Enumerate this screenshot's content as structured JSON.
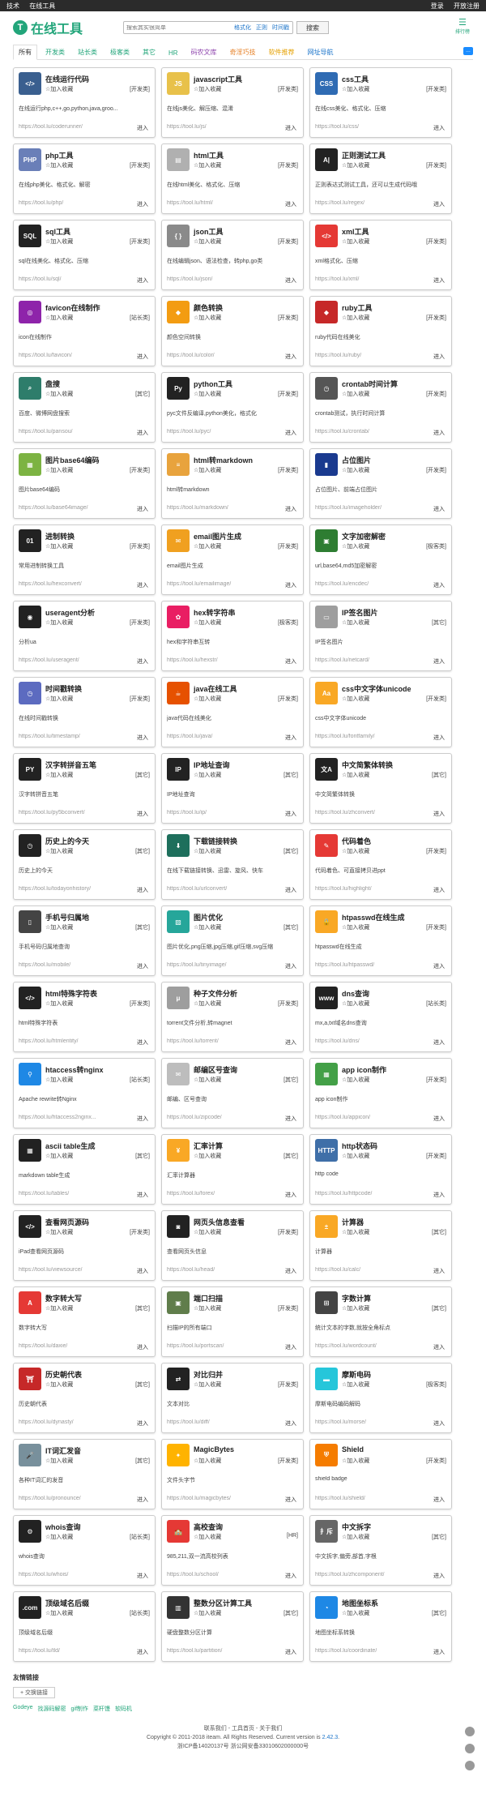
{
  "topbar": {
    "left": [
      "技术",
      "在线工具"
    ],
    "right": [
      "登录",
      "开放注册"
    ]
  },
  "header": {
    "logo_text": "在线工具",
    "search_placeholder": "搜索其实很简单",
    "search_tags": [
      "格式化",
      "正则",
      "时间戳"
    ],
    "search_button": "搜索",
    "ranking_label": "排行榜"
  },
  "nav": [
    "所有",
    "开发类",
    "站长类",
    "极客类",
    "其它",
    "HR",
    "码农文库",
    "奇淫巧技",
    "软件推荐",
    "网址导航"
  ],
  "common": {
    "fav": "☆加入收藏",
    "enter": "进入"
  },
  "tools": [
    {
      "title": "在线运行代码",
      "cat": "[开发类]",
      "desc": "在线运行php,c++,go,python,java,groo...",
      "url": "https://tool.lu/coderunner/",
      "color": "#3a5f8f",
      "glyph": "</>"
    },
    {
      "title": "javascript工具",
      "cat": "[开发类]",
      "desc": "在线js美化、解压缩、混淆",
      "url": "https://tool.lu/js/",
      "color": "#e8c14a",
      "glyph": "JS"
    },
    {
      "title": "css工具",
      "cat": "[开发类]",
      "desc": "在线css美化、格式化、压缩",
      "url": "https://tool.lu/css/",
      "color": "#2f6bb3",
      "glyph": "CSS"
    },
    {
      "title": "php工具",
      "cat": "[开发类]",
      "desc": "在线php美化、格式化、解密",
      "url": "https://tool.lu/php/",
      "color": "#6a7fb8",
      "glyph": "PHP"
    },
    {
      "title": "html工具",
      "cat": "[开发类]",
      "desc": "在线html美化、格式化、压缩",
      "url": "https://tool.lu/html/",
      "color": "#b0b0b0",
      "glyph": "▤"
    },
    {
      "title": "正则测试工具",
      "cat": "[开发类]",
      "desc": "正则表达式测试工具，还可以生成代码哦",
      "url": "https://tool.lu/regex/",
      "color": "#222",
      "glyph": "A|"
    },
    {
      "title": "sql工具",
      "cat": "[开发类]",
      "desc": "sql在线美化、格式化、压缩",
      "url": "https://tool.lu/sql/",
      "color": "#222",
      "glyph": "SQL"
    },
    {
      "title": "json工具",
      "cat": "[开发类]",
      "desc": "在线编辑json、语法检查，转php,go类",
      "url": "https://tool.lu/json/",
      "color": "#8a8a8a",
      "glyph": "{ }"
    },
    {
      "title": "xml工具",
      "cat": "[开发类]",
      "desc": "xml格式化、压缩",
      "url": "https://tool.lu/xml/",
      "color": "#e53935",
      "glyph": "</>"
    },
    {
      "title": "favicon在线制作",
      "cat": "[站长类]",
      "desc": "icon在线制作",
      "url": "https://tool.lu/favicon/",
      "color": "#8e24aa",
      "glyph": "◎"
    },
    {
      "title": "颜色转换",
      "cat": "[开发类]",
      "desc": "颜色空间转换",
      "url": "https://tool.lu/color/",
      "color": "#f39c12",
      "glyph": "◆"
    },
    {
      "title": "ruby工具",
      "cat": "[开发类]",
      "desc": "ruby代码在线美化",
      "url": "https://tool.lu/ruby/",
      "color": "#c62828",
      "glyph": "◆"
    },
    {
      "title": "盘搜",
      "cat": "[其它]",
      "desc": "百度、微博网盘搜索",
      "url": "https://tool.lu/pansou/",
      "color": "#2e7d6b",
      "glyph": "⌕"
    },
    {
      "title": "python工具",
      "cat": "[开发类]",
      "desc": "pyc文件反编译,python美化，格式化",
      "url": "https://tool.lu/pyc/",
      "color": "#222",
      "glyph": "Py"
    },
    {
      "title": "crontab时间计算",
      "cat": "[开发类]",
      "desc": "crontab测试，执行时间计算",
      "url": "https://tool.lu/crontab/",
      "color": "#555",
      "glyph": "◷"
    },
    {
      "title": "图片base64编码",
      "cat": "[开发类]",
      "desc": "图片base64编码",
      "url": "https://tool.lu/base64image/",
      "color": "#7cb342",
      "glyph": "▦"
    },
    {
      "title": "html转markdown",
      "cat": "[开发类]",
      "desc": "html转markdown",
      "url": "https://tool.lu/markdown/",
      "color": "#e8a33d",
      "glyph": "≡"
    },
    {
      "title": "占位图片",
      "cat": "[开发类]",
      "desc": "占位图片、前端占位图片",
      "url": "https://tool.lu/imageholder/",
      "color": "#1a3a8f",
      "glyph": "▮"
    },
    {
      "title": "进制转换",
      "cat": "[开发类]",
      "desc": "常用进制转换工具",
      "url": "https://tool.lu/hexconvert/",
      "color": "#222",
      "glyph": "01"
    },
    {
      "title": "email图片生成",
      "cat": "[开发类]",
      "desc": "email图片生成",
      "url": "https://tool.lu/emailimage/",
      "color": "#f0a020",
      "glyph": "✉"
    },
    {
      "title": "文字加密解密",
      "cat": "[极客类]",
      "desc": "url,base64,md5加密解密",
      "url": "https://tool.lu/encdec/",
      "color": "#2e7d32",
      "glyph": "▣"
    },
    {
      "title": "useragent分析",
      "cat": "[开发类]",
      "desc": "分析ua",
      "url": "https://tool.lu/useragent/",
      "color": "#222",
      "glyph": "◉"
    },
    {
      "title": "hex转字符串",
      "cat": "[极客类]",
      "desc": "hex和字符串互转",
      "url": "https://tool.lu/hexstr/",
      "color": "#e91e63",
      "glyph": "✿"
    },
    {
      "title": "IP签名图片",
      "cat": "[其它]",
      "desc": "IP签名图片",
      "url": "https://tool.lu/netcard/",
      "color": "#9e9e9e",
      "glyph": "▭"
    },
    {
      "title": "时间戳转换",
      "cat": "[开发类]",
      "desc": "在线时间戳转换",
      "url": "https://tool.lu/timestamp/",
      "color": "#5c6bc0",
      "glyph": "◷"
    },
    {
      "title": "java在线工具",
      "cat": "[开发类]",
      "desc": "java代码在线美化",
      "url": "https://tool.lu/java/",
      "color": "#e65100",
      "glyph": "☕"
    },
    {
      "title": "css中文字体unicode",
      "cat": "[开发类]",
      "desc": "css中文字体unicode",
      "url": "https://tool.lu/fontfamily/",
      "color": "#f9a825",
      "glyph": "Aa"
    },
    {
      "title": "汉字转拼音五笔",
      "cat": "[其它]",
      "desc": "汉字转拼音五笔",
      "url": "https://tool.lu/py5bconvert/",
      "color": "#222",
      "glyph": "PY"
    },
    {
      "title": "IP地址查询",
      "cat": "[其它]",
      "desc": "IP地址查询",
      "url": "https://tool.lu/ip/",
      "color": "#222",
      "glyph": "IP"
    },
    {
      "title": "中文简繁体转换",
      "cat": "[其它]",
      "desc": "中文简繁体转换",
      "url": "https://tool.lu/zhconvert/",
      "color": "#222",
      "glyph": "文A"
    },
    {
      "title": "历史上的今天",
      "cat": "[其它]",
      "desc": "历史上的今天",
      "url": "https://tool.lu/todayonhistory/",
      "color": "#222",
      "glyph": "◷"
    },
    {
      "title": "下载链接转换",
      "cat": "[其它]",
      "desc": "在线下载链接转换、迅雷、旋风、快车",
      "url": "https://tool.lu/urlconvert/",
      "color": "#1e6f5c",
      "glyph": "⬇"
    },
    {
      "title": "代码着色",
      "cat": "[开发类]",
      "desc": "代码着色、可直接拷贝进ppt",
      "url": "https://tool.lu/highlight/",
      "color": "#e53935",
      "glyph": "✎"
    },
    {
      "title": "手机号归属地",
      "cat": "[其它]",
      "desc": "手机号码归属地查询",
      "url": "https://tool.lu/mobile/",
      "color": "#444",
      "glyph": "▯"
    },
    {
      "title": "图片优化",
      "cat": "[其它]",
      "desc": "图片优化,png压缩,jpg压缩,gif压缩,svg压缩",
      "url": "https://tool.lu/tinyimage/",
      "color": "#26a69a",
      "glyph": "▨"
    },
    {
      "title": "htpasswd在线生成",
      "cat": "[开发类]",
      "desc": "htpasswd在线生成",
      "url": "https://tool.lu/htpasswd/",
      "color": "#f9a825",
      "glyph": "🔒"
    },
    {
      "title": "html特殊字符表",
      "cat": "[开发类]",
      "desc": "html特殊字符表",
      "url": "https://tool.lu/htmlentity/",
      "color": "#222",
      "glyph": "</>"
    },
    {
      "title": "种子文件分析",
      "cat": "[开发类]",
      "desc": "torrent文件分析,转magnet",
      "url": "https://tool.lu/torrent/",
      "color": "#9e9e9e",
      "glyph": "μ"
    },
    {
      "title": "dns查询",
      "cat": "[站长类]",
      "desc": "mx,a,txt域名dns查询",
      "url": "https://tool.lu/dns/",
      "color": "#222",
      "glyph": "www"
    },
    {
      "title": "htaccess转nginx",
      "cat": "[站长类]",
      "desc": "Apache rewrite转Nginx",
      "url": "https://tool.lu/htaccess2nginx...",
      "color": "#1e88e5",
      "glyph": "⚲"
    },
    {
      "title": "邮编区号查询",
      "cat": "[其它]",
      "desc": "邮编、区号查询",
      "url": "https://tool.lu/zipcode/",
      "color": "#bdbdbd",
      "glyph": "✉"
    },
    {
      "title": "app icon制作",
      "cat": "[开发类]",
      "desc": "app icon制作",
      "url": "https://tool.lu/appicon/",
      "color": "#43a047",
      "glyph": "▦"
    },
    {
      "title": "ascii table生成",
      "cat": "[其它]",
      "desc": "markdown table生成",
      "url": "https://tool.lu/tables/",
      "color": "#222",
      "glyph": "▦"
    },
    {
      "title": "汇率计算",
      "cat": "[其它]",
      "desc": "汇率计算器",
      "url": "https://tool.lu/forex/",
      "color": "#f9a825",
      "glyph": "¥"
    },
    {
      "title": "http状态码",
      "cat": "[开发类]",
      "desc": "http code",
      "url": "https://tool.lu/httpcode/",
      "color": "#3f6fa8",
      "glyph": "HTTP"
    },
    {
      "title": "查看网页源码",
      "cat": "[开发类]",
      "desc": "iPad查看网页源码",
      "url": "https://tool.lu/viewsource/",
      "color": "#222",
      "glyph": "</>"
    },
    {
      "title": "网页头信息查看",
      "cat": "[开发类]",
      "desc": "查看网页头信息",
      "url": "https://tool.lu/head/",
      "color": "#222",
      "glyph": "◙"
    },
    {
      "title": "计算器",
      "cat": "[其它]",
      "desc": "计算器",
      "url": "https://tool.lu/calc/",
      "color": "#f9a825",
      "glyph": "±"
    },
    {
      "title": "数字转大写",
      "cat": "[其它]",
      "desc": "数字转大写",
      "url": "https://tool.lu/daxie/",
      "color": "#e53935",
      "glyph": "A"
    },
    {
      "title": "端口扫描",
      "cat": "[开发类]",
      "desc": "扫描IP的所有端口",
      "url": "https://tool.lu/portscan/",
      "color": "#607d4b",
      "glyph": "▣"
    },
    {
      "title": "字数计算",
      "cat": "[其它]",
      "desc": "统计文本的字数,就按全角标点",
      "url": "https://tool.lu/wordcount/",
      "color": "#444",
      "glyph": "⊞"
    },
    {
      "title": "历史朝代表",
      "cat": "[其它]",
      "desc": "历史朝代表",
      "url": "https://tool.lu/dynasty/",
      "color": "#c62828",
      "glyph": "⛩"
    },
    {
      "title": "对比归并",
      "cat": "[开发类]",
      "desc": "文本对比",
      "url": "https://tool.lu/diff/",
      "color": "#222",
      "glyph": "⇄"
    },
    {
      "title": "摩斯电码",
      "cat": "[极客类]",
      "desc": "摩斯电码编码解码",
      "url": "https://tool.lu/morse/",
      "color": "#26c6da",
      "glyph": "▬"
    },
    {
      "title": "IT词汇发音",
      "cat": "[其它]",
      "desc": "各种IT词汇的发音",
      "url": "https://tool.lu/pronounce/",
      "color": "#78909c",
      "glyph": "🎤"
    },
    {
      "title": "MagicBytes",
      "cat": "[开发类]",
      "desc": "文件头字节",
      "url": "https://tool.lu/magicbytes/",
      "color": "#ffb300",
      "glyph": "✦"
    },
    {
      "title": "Shield",
      "cat": "[开发类]",
      "desc": "shield badge",
      "url": "https://tool.lu/shield/",
      "color": "#f57c00",
      "glyph": "⛨"
    },
    {
      "title": "whois查询",
      "cat": "[站长类]",
      "desc": "whois查询",
      "url": "https://tool.lu/whois/",
      "color": "#222",
      "glyph": "⚙"
    },
    {
      "title": "高校查询",
      "cat": "[HR]",
      "desc": "985,211,双一流高校列表",
      "url": "https://tool.lu/school/",
      "color": "#e53935",
      "glyph": "🏫"
    },
    {
      "title": "中文拆字",
      "cat": "[其它]",
      "desc": "中文拆字,偏旁,部首,字根",
      "url": "https://tool.lu/zhcomponent/",
      "color": "#666",
      "glyph": "扌斥"
    },
    {
      "title": "顶级域名后缀",
      "cat": "[站长类]",
      "desc": "顶级域名后缀",
      "url": "https://tool.lu/tld/",
      "color": "#222",
      "glyph": ".com"
    },
    {
      "title": "整数分区计算工具",
      "cat": "[其它]",
      "desc": "硬盘整数分区计算",
      "url": "https://tool.lu/partition/",
      "color": "#333",
      "glyph": "▥"
    },
    {
      "title": "地图坐标系",
      "cat": "[其它]",
      "desc": "地图坐标系转换",
      "url": "https://tool.lu/coordinate/",
      "color": "#1e88e5",
      "glyph": "◔"
    }
  ],
  "friends": {
    "title": "友情链接",
    "button": "+ 交换链接",
    "links": [
      "Godeye",
      "找源码解密",
      "gif制作",
      "菜杆馒",
      "软码机"
    ]
  },
  "footer": {
    "line1": "联系我们 - 工具首页 - 关于我们",
    "line2": "Copyright © 2011-2018 iteam. All Rights Reserved. Current version is",
    "version": "2.42.3",
    "line3": "浙ICP备14020137号 浙公网安备33010602000000号"
  }
}
